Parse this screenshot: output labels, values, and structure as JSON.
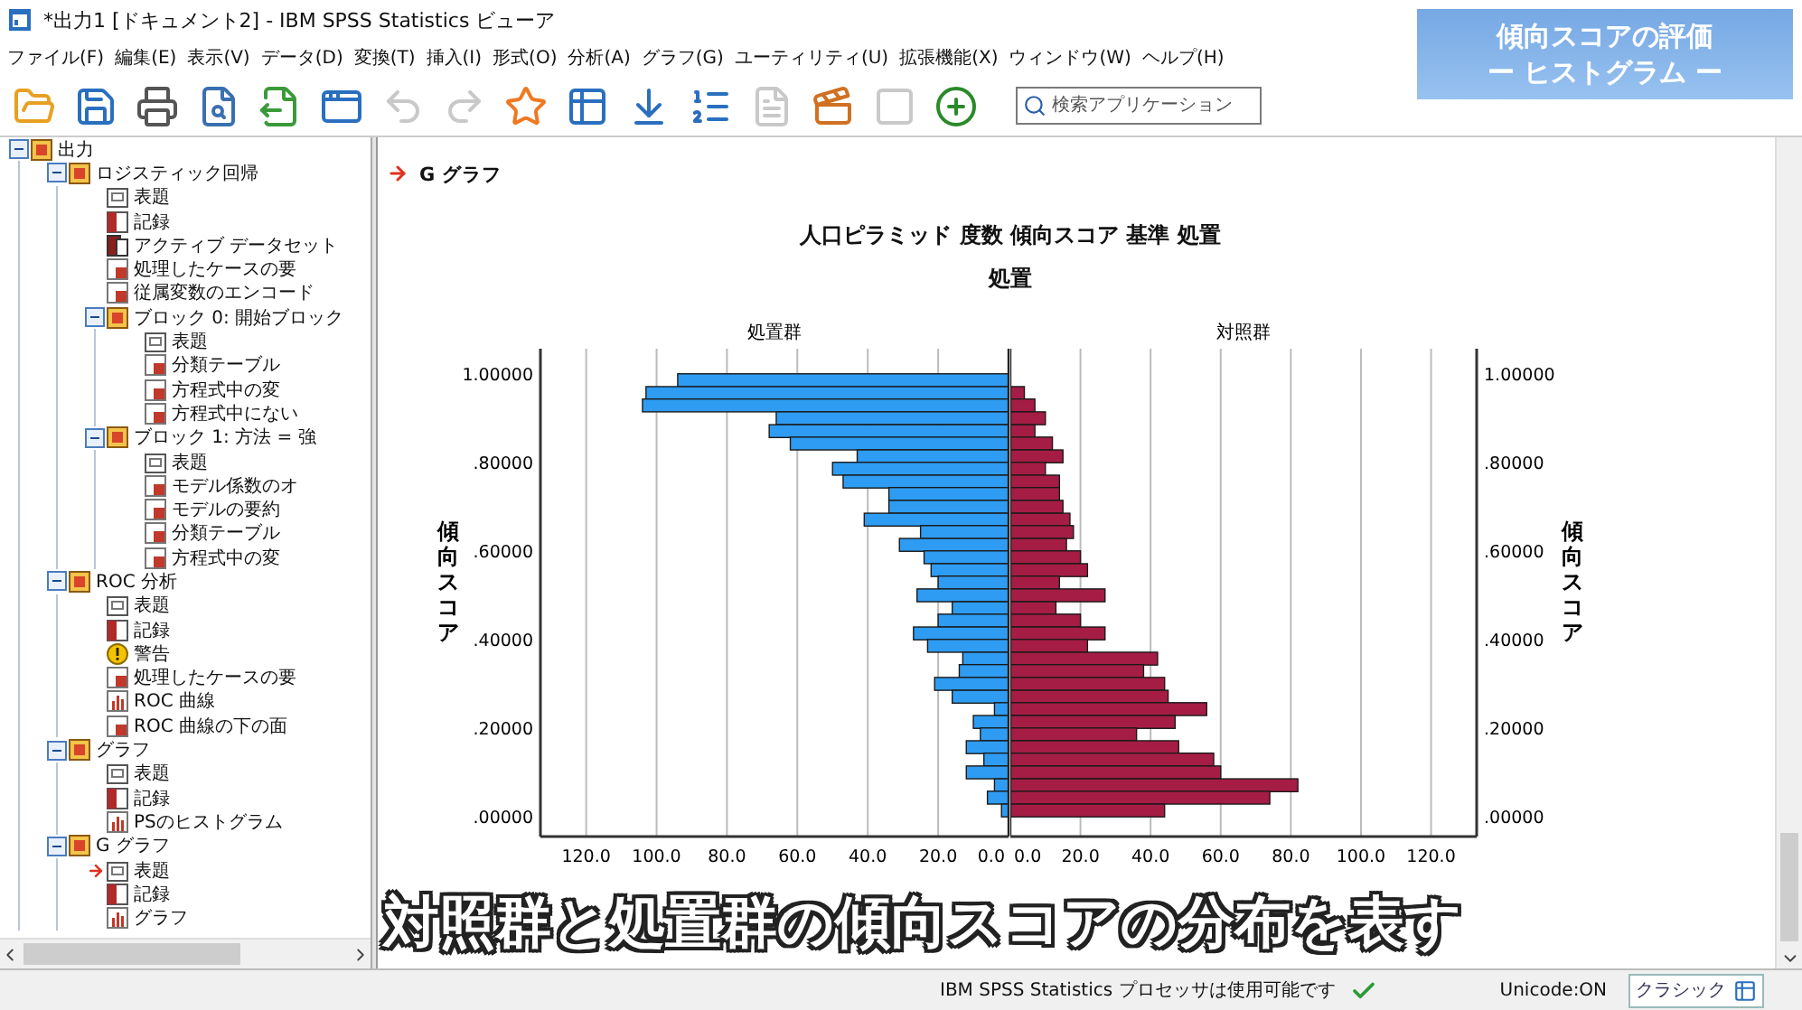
{
  "window": {
    "title": "*出力1 [ドキュメント2] - IBM SPSS Statistics ビューア"
  },
  "menu": [
    "ファイル(F)",
    "編集(E)",
    "表示(V)",
    "データ(D)",
    "変換(T)",
    "挿入(I)",
    "形式(O)",
    "分析(A)",
    "グラフ(G)",
    "ユーティリティ(U)",
    "拡張機能(X)",
    "ウィンドウ(W)",
    "ヘルプ(H)"
  ],
  "toolbar": [
    {
      "kind": "open",
      "disabled": false
    },
    {
      "kind": "save",
      "disabled": false
    },
    {
      "kind": "print",
      "disabled": false
    },
    {
      "kind": "preview",
      "disabled": false
    },
    {
      "kind": "export",
      "disabled": false
    },
    {
      "kind": "recall",
      "disabled": false
    },
    {
      "kind": "undo",
      "disabled": true
    },
    {
      "kind": "redo",
      "disabled": true
    },
    {
      "kind": "goto_case",
      "disabled": false
    },
    {
      "kind": "goto_variable",
      "disabled": false
    },
    {
      "kind": "insert",
      "disabled": false
    },
    {
      "kind": "variables",
      "disabled": false
    },
    {
      "kind": "document",
      "disabled": true
    },
    {
      "kind": "run",
      "disabled": false
    },
    {
      "kind": "box",
      "disabled": true
    },
    {
      "kind": "designate",
      "disabled": false
    }
  ],
  "search": {
    "placeholder": "検索アプリケーション"
  },
  "banner": {
    "lines": [
      "傾向スコアの評価",
      "ー ヒストグラム ー"
    ]
  },
  "tree": [
    {
      "label": "出力",
      "kind": "heading",
      "expanded": true,
      "selected": false,
      "children": [
        {
          "label": "ロジスティック回帰",
          "kind": "heading",
          "expanded": true,
          "selected": false,
          "children": [
            {
              "label": "表題",
              "kind": "title",
              "selected": false
            },
            {
              "label": "記録",
              "kind": "log",
              "selected": false
            },
            {
              "label": "アクティブ データセット",
              "kind": "dataset",
              "selected": false
            },
            {
              "label": "処理したケースの要",
              "kind": "table",
              "selected": false
            },
            {
              "label": "従属変数のエンコード",
              "kind": "table",
              "selected": false
            },
            {
              "label": "ブロック 0: 開始ブロック",
              "kind": "heading",
              "expanded": true,
              "selected": false,
              "children": [
                {
                  "label": "表題",
                  "kind": "title",
                  "selected": false
                },
                {
                  "label": "分類テーブル",
                  "kind": "table",
                  "selected": false
                },
                {
                  "label": "方程式中の変",
                  "kind": "table",
                  "selected": false
                },
                {
                  "label": "方程式中にない",
                  "kind": "table",
                  "selected": false
                }
              ]
            },
            {
              "label": "ブロック 1: 方法 = 強",
              "kind": "heading",
              "expanded": true,
              "selected": false,
              "children": [
                {
                  "label": "表題",
                  "kind": "title",
                  "selected": false
                },
                {
                  "label": "モデル係数のオ",
                  "kind": "table",
                  "selected": false
                },
                {
                  "label": "モデルの要約",
                  "kind": "table",
                  "selected": false
                },
                {
                  "label": "分類テーブル",
                  "kind": "table",
                  "selected": false
                },
                {
                  "label": "方程式中の変",
                  "kind": "table",
                  "selected": false
                }
              ]
            }
          ]
        },
        {
          "label": "ROC 分析",
          "kind": "heading",
          "expanded": true,
          "selected": false,
          "children": [
            {
              "label": "表題",
              "kind": "title",
              "selected": false
            },
            {
              "label": "記録",
              "kind": "log",
              "selected": false
            },
            {
              "label": "警告",
              "kind": "warning",
              "selected": false
            },
            {
              "label": "処理したケースの要",
              "kind": "table",
              "selected": false
            },
            {
              "label": "ROC 曲線",
              "kind": "chart",
              "selected": false
            },
            {
              "label": "ROC 曲線の下の面",
              "kind": "table",
              "selected": false
            }
          ]
        },
        {
          "label": "グラフ",
          "kind": "heading",
          "expanded": true,
          "selected": false,
          "children": [
            {
              "label": "表題",
              "kind": "title",
              "selected": false
            },
            {
              "label": "記録",
              "kind": "log",
              "selected": false
            },
            {
              "label": "PSのヒストグラム",
              "kind": "chart",
              "selected": false
            }
          ]
        },
        {
          "label": "G グラフ",
          "kind": "heading",
          "expanded": true,
          "selected": false,
          "children": [
            {
              "label": "表題",
              "kind": "title",
              "selected": true
            },
            {
              "label": "記録",
              "kind": "log",
              "selected": false
            },
            {
              "label": "グラフ",
              "kind": "chart",
              "selected": false
            }
          ]
        }
      ]
    }
  ],
  "content": {
    "heading": "G グラフ",
    "pyramid": {
      "title": "人口ピラミッド 度数 傾向スコア 基準 処置",
      "subtitle": "処置",
      "left": {
        "chart_data": {
          "type": "bar",
          "orientation": "horizontal",
          "title": "処置群",
          "ylabel": "傾向スコア",
          "x": [
            0.986,
            0.957,
            0.929,
            0.9,
            0.871,
            0.843,
            0.814,
            0.786,
            0.757,
            0.729,
            0.7,
            0.671,
            0.643,
            0.614,
            0.586,
            0.557,
            0.529,
            0.5,
            0.471,
            0.443,
            0.414,
            0.386,
            0.357,
            0.329,
            0.3,
            0.271,
            0.243,
            0.214,
            0.186,
            0.157,
            0.129,
            0.1,
            0.071,
            0.043,
            0.014
          ],
          "series": [
            {
              "color": "#2e9cf2",
              "values": [
                94,
                103,
                104,
                66,
                68,
                62,
                43,
                50,
                47,
                34,
                34,
                41,
                25,
                31,
                24,
                22,
                20,
                26,
                16,
                20,
                27,
                23,
                13,
                14,
                21,
                16,
                4,
                10,
                8,
                12,
                7,
                12,
                4,
                6,
                2
              ]
            }
          ],
          "xlim": [
            133,
            0
          ],
          "ylim": [
            -0.045,
            1.057
          ],
          "grid": true,
          "xticks": [
            {
              "value": 120,
              "label": "120.0"
            },
            {
              "value": 100,
              "label": "100.0"
            },
            {
              "value": 80,
              "label": "80.0"
            },
            {
              "value": 60,
              "label": "60.0"
            },
            {
              "value": 40,
              "label": "40.0"
            },
            {
              "value": 20,
              "label": "20.0"
            },
            {
              "value": 0,
              "label": "0.0"
            }
          ],
          "yticks": [
            {
              "value": 0,
              "label": ".00000"
            },
            {
              "value": 0.2,
              "label": ".20000"
            },
            {
              "value": 0.4,
              "label": ".40000"
            },
            {
              "value": 0.6,
              "label": ".60000"
            },
            {
              "value": 0.8,
              "label": ".80000"
            },
            {
              "value": 1,
              "label": "1.00000"
            }
          ]
        }
      },
      "right": {
        "chart_data": {
          "type": "bar",
          "orientation": "horizontal",
          "title": "対照群",
          "ylabel": "傾向スコア",
          "x": [
            0.986,
            0.957,
            0.929,
            0.9,
            0.871,
            0.843,
            0.814,
            0.786,
            0.757,
            0.729,
            0.7,
            0.671,
            0.643,
            0.614,
            0.586,
            0.557,
            0.529,
            0.5,
            0.471,
            0.443,
            0.414,
            0.386,
            0.357,
            0.329,
            0.3,
            0.271,
            0.243,
            0.214,
            0.186,
            0.157,
            0.129,
            0.1,
            0.071,
            0.043,
            0.014
          ],
          "series": [
            {
              "color": "#a51d45",
              "values": [
                0,
                4,
                7,
                10,
                7,
                12,
                15,
                10,
                14,
                14,
                15,
                17,
                18,
                16,
                20,
                22,
                14,
                27,
                13,
                20,
                27,
                22,
                42,
                38,
                44,
                45,
                56,
                47,
                36,
                48,
                58,
                60,
                82,
                74,
                44
              ]
            }
          ],
          "xlim": [
            0,
            133
          ],
          "ylim": [
            -0.045,
            1.057
          ],
          "grid": true,
          "xticks": [
            {
              "value": 0,
              "label": "0.0"
            },
            {
              "value": 20,
              "label": "20.0"
            },
            {
              "value": 40,
              "label": "40.0"
            },
            {
              "value": 60,
              "label": "60.0"
            },
            {
              "value": 80,
              "label": "80.0"
            },
            {
              "value": 100,
              "label": "100.0"
            },
            {
              "value": 120,
              "label": "120.0"
            }
          ],
          "yticks": [
            {
              "value": 0,
              "label": ".00000"
            },
            {
              "value": 0.2,
              "label": ".20000"
            },
            {
              "value": 0.4,
              "label": ".40000"
            },
            {
              "value": 0.6,
              "label": ".60000"
            },
            {
              "value": 0.8,
              "label": ".80000"
            },
            {
              "value": 1,
              "label": "1.00000"
            }
          ]
        }
      }
    }
  },
  "caption": "対照群と処置群の傾向スコアの分布を表す",
  "status_bar": {
    "message": "IBM SPSS Statistics プロセッサは使用可能です",
    "encoding": "Unicode:ON",
    "mode_button": "クラシック"
  }
}
